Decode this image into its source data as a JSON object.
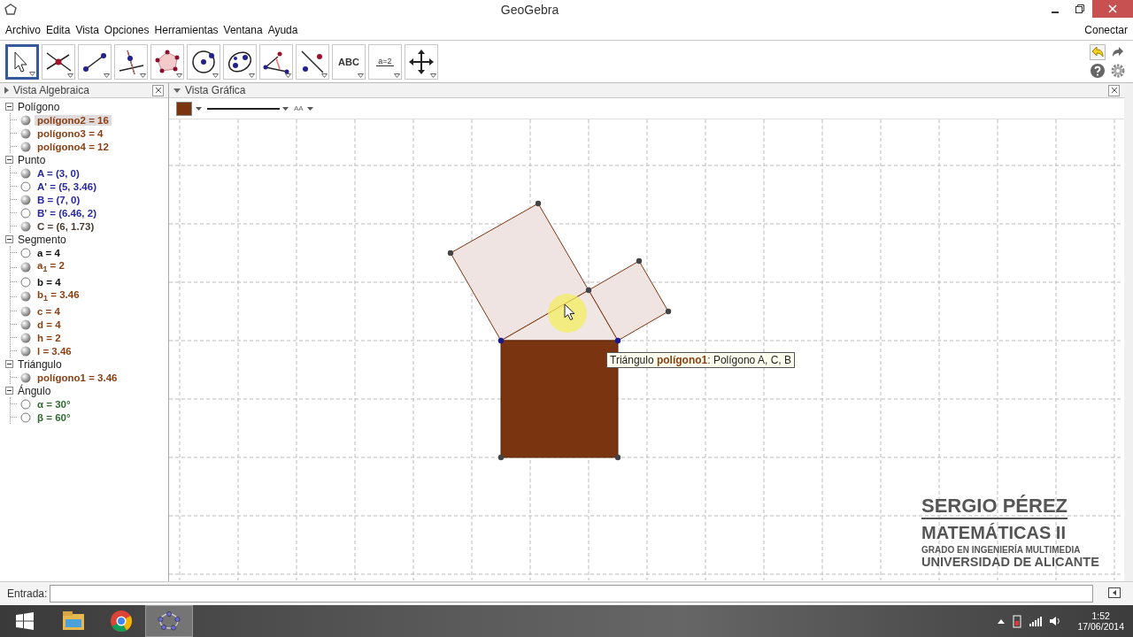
{
  "window": {
    "title": "GeoGebra"
  },
  "menu": [
    {
      "label": "Archivo"
    },
    {
      "label": "Edita"
    },
    {
      "label": "Vista"
    },
    {
      "label": "Opciones"
    },
    {
      "label": "Herramientas"
    },
    {
      "label": "Ventana"
    },
    {
      "label": "Ayuda"
    }
  ],
  "connect": "Conectar",
  "toolbar": [
    {
      "kind": "move",
      "selected": true
    },
    {
      "kind": "point",
      "selected": false
    },
    {
      "kind": "segment",
      "selected": false
    },
    {
      "kind": "perpendicular",
      "selected": false
    },
    {
      "kind": "polygon",
      "selected": false
    },
    {
      "kind": "circle",
      "selected": false
    },
    {
      "kind": "conic",
      "selected": false
    },
    {
      "kind": "angle",
      "selected": false
    },
    {
      "kind": "reflect",
      "selected": false
    },
    {
      "kind": "text",
      "label": "ABC",
      "selected": false
    },
    {
      "kind": "slider",
      "label": "a=2",
      "selected": false
    },
    {
      "kind": "pan",
      "selected": false
    }
  ],
  "algebra_view": {
    "title": "Vista Algebraica",
    "groups": [
      {
        "label": "Polígono",
        "expanded": true,
        "children": [
          {
            "label": "polígono2 = 16",
            "visible": true,
            "selected": true,
            "color": "#8b3f14"
          },
          {
            "label": "polígono3 = 4",
            "visible": true,
            "selected": false,
            "color": "#8b3f14"
          },
          {
            "label": "polígono4 = 12",
            "visible": true,
            "selected": false,
            "color": "#8b3f14"
          }
        ]
      },
      {
        "label": "Punto",
        "expanded": true,
        "children": [
          {
            "label": "A = (3, 0)",
            "visible": true,
            "selected": false,
            "color": "#2828a0"
          },
          {
            "label": "A' = (5, 3.46)",
            "visible": false,
            "selected": false,
            "color": "#2828a0"
          },
          {
            "label": "B = (7, 0)",
            "visible": true,
            "selected": false,
            "color": "#2828a0"
          },
          {
            "label": "B' = (6.46, 2)",
            "visible": false,
            "selected": false,
            "color": "#2828a0"
          },
          {
            "label": "C = (6, 1.73)",
            "visible": true,
            "selected": false,
            "color": "#4a3b30"
          }
        ]
      },
      {
        "label": "Segmento",
        "expanded": true,
        "children": [
          {
            "label": "a = 4",
            "visible": false,
            "selected": false,
            "color": "#111111"
          },
          {
            "label": "a$_{1}$ = 2",
            "visible": true,
            "selected": false,
            "color": "#8b3f14"
          },
          {
            "label": "b = 4",
            "visible": false,
            "selected": false,
            "color": "#111111"
          },
          {
            "label": "b$_{1}$ = 3.46",
            "visible": true,
            "selected": false,
            "color": "#8b3f14"
          },
          {
            "label": "c = 4",
            "visible": true,
            "selected": false,
            "color": "#8b3f14"
          },
          {
            "label": "d = 4",
            "visible": true,
            "selected": false,
            "color": "#8b3f14"
          },
          {
            "label": "h = 2",
            "visible": true,
            "selected": false,
            "color": "#8b3f14"
          },
          {
            "label": "l = 3.46",
            "visible": true,
            "selected": false,
            "color": "#8b3f14"
          }
        ]
      },
      {
        "label": "Triángulo",
        "expanded": true,
        "children": [
          {
            "label": "polígono1 = 3.46",
            "visible": true,
            "selected": false,
            "color": "#8b3f14"
          }
        ]
      },
      {
        "label": "Ángulo",
        "expanded": true,
        "children": [
          {
            "label": "α = 30°",
            "visible": false,
            "selected": false,
            "color": "#2e6b2e"
          },
          {
            "label": "β = 60°",
            "visible": false,
            "selected": false,
            "color": "#2e6b2e"
          }
        ]
      }
    ]
  },
  "graphics_view": {
    "title": "Vista Gráfica",
    "style_bar": {
      "color": "#7a3410",
      "size_label": "AA"
    },
    "tooltip": "Triángulo **polígono1**: Polígono A, C, B"
  },
  "overlay": [
    {
      "kind": "name",
      "text": "SERGIO PÉREZ"
    },
    {
      "kind": "subject",
      "text": "MATEMÁTICAS II"
    },
    {
      "kind": "degree",
      "text": "GRADO EN INGENIERÍA MULTIMEDIA"
    },
    {
      "kind": "university",
      "text": "UNIVERSIDAD DE ALICANTE"
    }
  ],
  "input_bar": {
    "label": "Entrada:"
  },
  "taskbar": {
    "apps": [
      {
        "kind": "explorer",
        "active": false
      },
      {
        "kind": "chrome",
        "active": false
      },
      {
        "kind": "geogebra",
        "active": true
      }
    ],
    "time": "1:52",
    "date": "17/06/2014"
  }
}
